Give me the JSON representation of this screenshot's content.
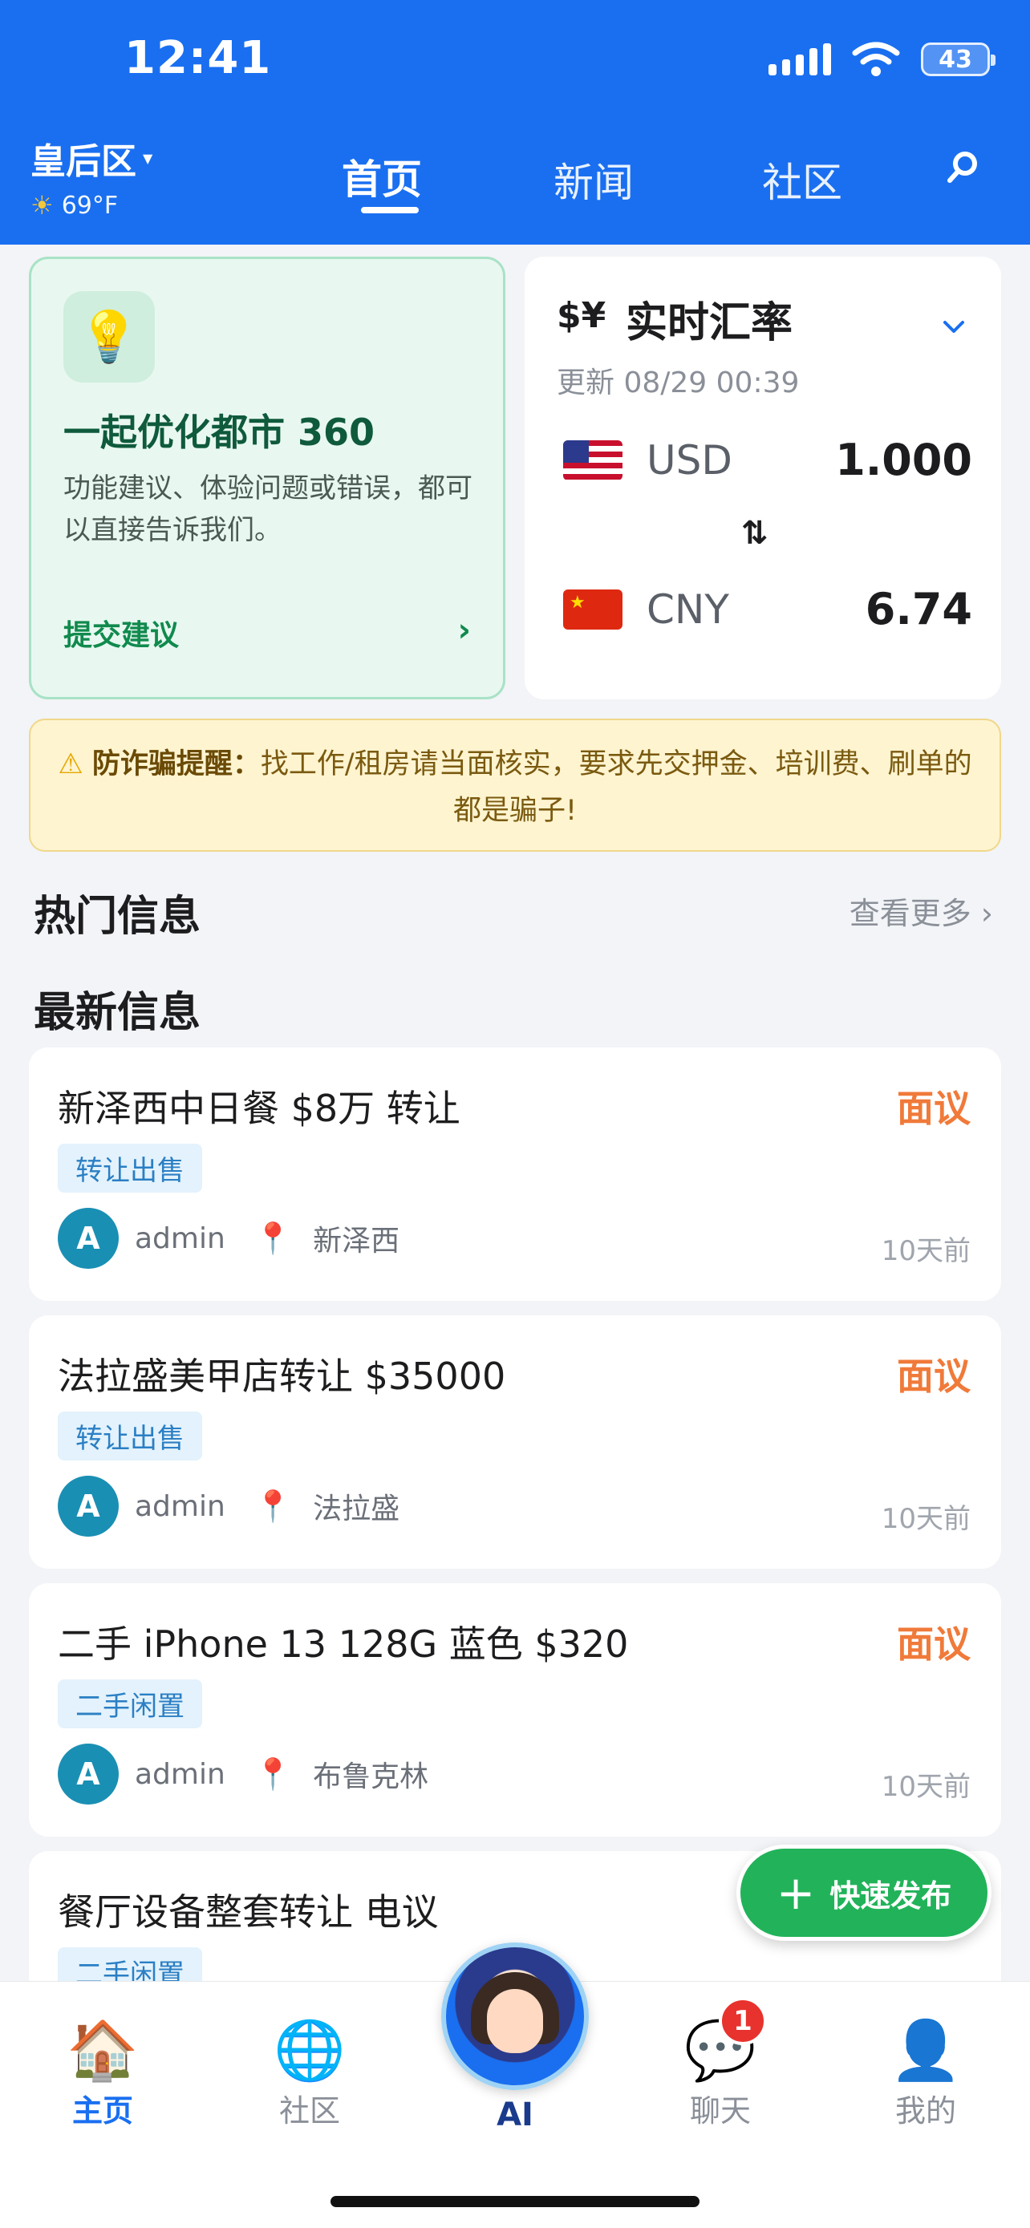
{
  "status": {
    "time": "12:41",
    "battery": "43"
  },
  "location": {
    "name": "皇后区",
    "weather": "69°F"
  },
  "nav": {
    "tabs": [
      "首页",
      "新闻",
      "社区"
    ],
    "active": "首页"
  },
  "suggest": {
    "title": "一起优化都市 360",
    "body": "功能建议、体验问题或错误，都可以直接告诉我们。",
    "link": "提交建议"
  },
  "rate": {
    "title": "实时汇率",
    "updated": "更新 08/29 00:39",
    "from_code": "USD",
    "from_value": "1.000",
    "to_code": "CNY",
    "to_value": "6.74"
  },
  "alert": {
    "label": "防诈骗提醒：",
    "text": "找工作/租房请当面核实，要求先交押金、培训费、刷单的都是骗子!"
  },
  "sections": {
    "hot": "热门信息",
    "more": "查看更多 ›",
    "latest": "最新信息"
  },
  "listings": [
    {
      "title": "新泽西中日餐 $8万 转让",
      "price": "面议",
      "tag": "转让出售",
      "user": "admin",
      "avatar": "A",
      "location": "新泽西",
      "time": "10天前"
    },
    {
      "title": "法拉盛美甲店转让 $35000",
      "price": "面议",
      "tag": "转让出售",
      "user": "admin",
      "avatar": "A",
      "location": "法拉盛",
      "time": "10天前"
    },
    {
      "title": "二手 iPhone 13 128G 蓝色 $320",
      "price": "面议",
      "tag": "二手闲置",
      "user": "admin",
      "avatar": "A",
      "location": "布鲁克林",
      "time": "10天前"
    },
    {
      "title": "餐厅设备整套转让 电议",
      "tag": "二手闲置"
    }
  ],
  "fab": {
    "label": "快速发布"
  },
  "tabbar": {
    "home": "主页",
    "community": "社区",
    "ai": "AI",
    "chat": "聊天",
    "me": "我的",
    "chat_badge": "1"
  },
  "colors": {
    "primary": "#1a6ff0",
    "accent_green": "#22b35a",
    "price": "#f07a3a"
  }
}
